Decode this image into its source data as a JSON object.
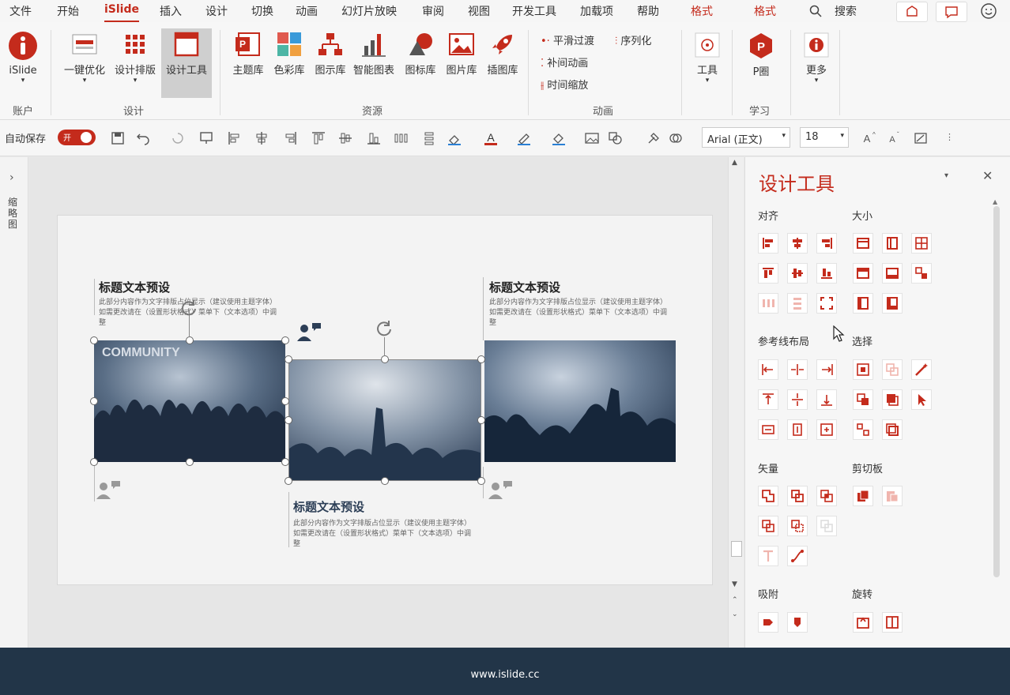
{
  "menu": {
    "items": [
      {
        "label": "文件"
      },
      {
        "label": "开始"
      },
      {
        "label": "iSlide"
      },
      {
        "label": "插入"
      },
      {
        "label": "设计"
      },
      {
        "label": "切换"
      },
      {
        "label": "动画"
      },
      {
        "label": "幻灯片放映"
      },
      {
        "label": "审阅"
      },
      {
        "label": "视图"
      },
      {
        "label": "开发工具"
      },
      {
        "label": "加载项"
      },
      {
        "label": "帮助"
      },
      {
        "label": "格式"
      },
      {
        "label": "格式"
      }
    ],
    "search": "搜索",
    "active": "iSlide"
  },
  "ribbon": {
    "account": {
      "label": "iSlide",
      "group": "账户"
    },
    "design": {
      "items": [
        {
          "label": "一键优化"
        },
        {
          "label": "设计排版"
        },
        {
          "label": "设计工具"
        }
      ],
      "group": "设计"
    },
    "resources": {
      "items": [
        {
          "label": "主题库"
        },
        {
          "label": "色彩库"
        },
        {
          "label": "图示库"
        },
        {
          "label": "智能图表"
        },
        {
          "label": "图标库"
        },
        {
          "label": "图片库"
        },
        {
          "label": "插图库"
        }
      ],
      "group": "资源"
    },
    "animation": {
      "items": [
        {
          "label": "平滑过渡"
        },
        {
          "label": "序列化"
        },
        {
          "label": "补间动画"
        },
        {
          "label": "时间缩放"
        }
      ],
      "group": "动画"
    },
    "tools": {
      "label": "工具"
    },
    "learn": {
      "label": "P圈",
      "group": "学习"
    },
    "more": {
      "label": "更多"
    }
  },
  "qat": {
    "autosave": "自动保存",
    "toggle": "开",
    "font": "Arial (正文)",
    "size": "18"
  },
  "leftpane": {
    "label": "缩略图"
  },
  "slide": {
    "title1": "标题文本预设",
    "body1a": "此部分内容作为文字排版占位显示（建议使用主题字体）",
    "body1b": "如需更改请在（设置形状格式）菜单下（文本选项）中调整",
    "title2": "标题文本预设",
    "body2a": "此部分内容作为文字排版占位显示（建议使用主题字体）",
    "body2b": "如需更改请在（设置形状格式）菜单下（文本选项）中调整",
    "title3": "标题文本预设",
    "body3a": "此部分内容作为文字排版占位显示（建议使用主题字体）",
    "body3b": "如需更改请在（设置形状格式）菜单下（文本选项）中调整",
    "community": "COMMUNITY"
  },
  "panel": {
    "title": "设计工具",
    "sections": {
      "align": "对齐",
      "size": "大小",
      "guides": "参考线布局",
      "select": "选择",
      "vector": "矢量",
      "clipboard": "剪切板",
      "snap": "吸附",
      "rotate": "旋转"
    }
  },
  "footer": {
    "text": "www.islide.cc"
  },
  "colors": {
    "accent": "#c42b1c",
    "footer": "#223548",
    "photo": "#2c3e56"
  }
}
